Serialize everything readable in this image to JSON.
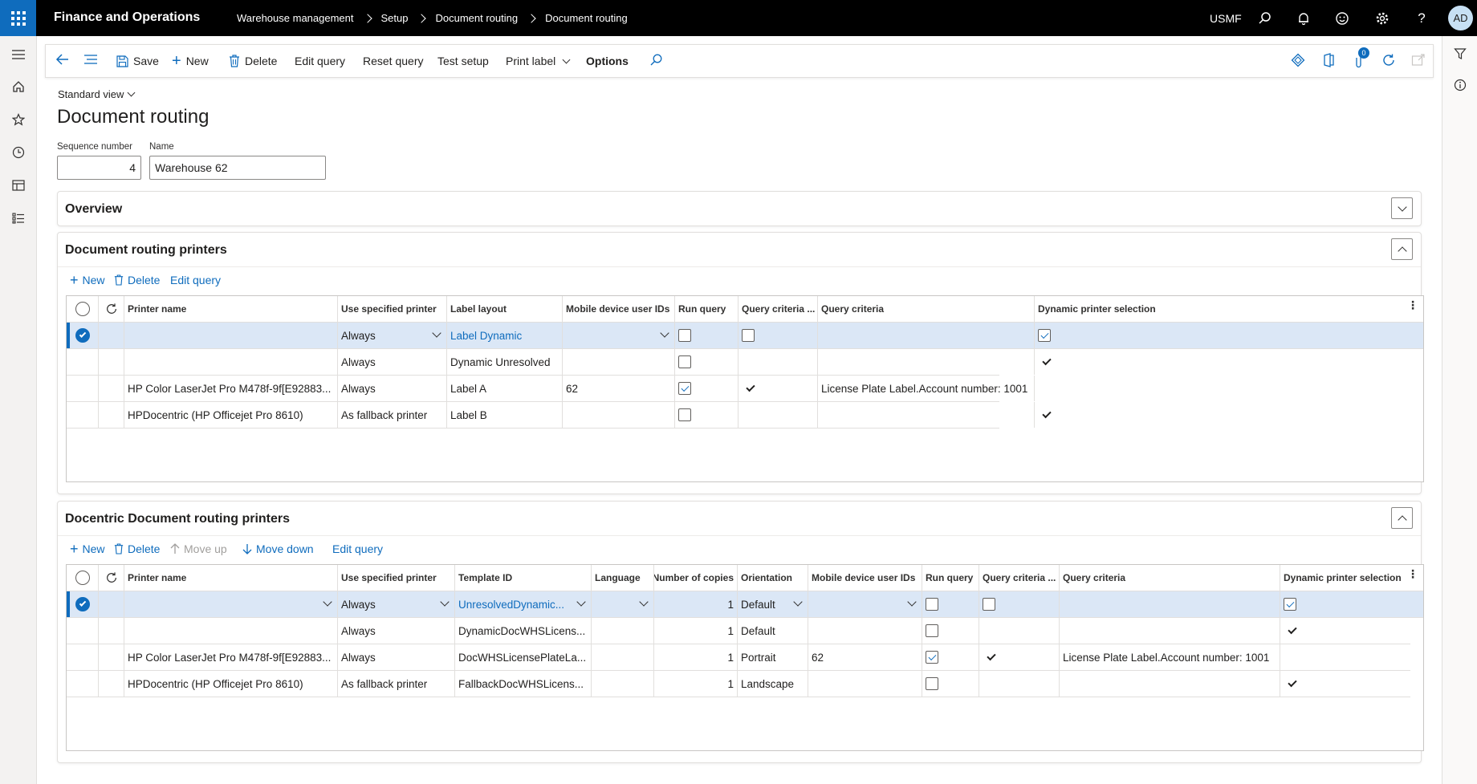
{
  "topbar": {
    "app_name": "Finance and Operations",
    "breadcrumbs": [
      "Warehouse management",
      "Setup",
      "Document routing",
      "Document routing"
    ],
    "company": "USMF",
    "avatar_initials": "AD"
  },
  "actions": {
    "save": "Save",
    "new": "New",
    "delete": "Delete",
    "edit_query": "Edit query",
    "reset_query": "Reset query",
    "test_setup": "Test setup",
    "print_label": "Print label",
    "options": "Options",
    "badge_count": "0"
  },
  "page": {
    "view_label": "Standard view",
    "title": "Document routing",
    "sequence_label": "Sequence number",
    "sequence_value": "4",
    "name_label": "Name",
    "name_value": "Warehouse 62"
  },
  "overview": {
    "title": "Overview"
  },
  "routing_printers": {
    "title": "Document routing printers",
    "toolbar": {
      "new": "New",
      "delete": "Delete",
      "edit_query": "Edit query"
    },
    "columns": [
      "Printer name",
      "Use specified printer",
      "Label layout",
      "Mobile device user IDs",
      "Run query",
      "Query criteria ...",
      "Query criteria",
      "Dynamic printer selection"
    ],
    "rows": [
      {
        "printer": "",
        "use": "Always",
        "layout": "Label Dynamic",
        "mobile": "",
        "run_query": false,
        "qc_flag": false,
        "criteria": "",
        "dynamic": true
      },
      {
        "printer": "",
        "use": "Always",
        "layout": "Dynamic Unresolved",
        "mobile": "",
        "run_query": false,
        "qc_flag": false,
        "criteria": "",
        "dynamic": true
      },
      {
        "printer": "HP Color LaserJet Pro M478f-9f[E92883...",
        "use": "Always",
        "layout": "Label A",
        "mobile": "62",
        "run_query": true,
        "qc_flag": true,
        "criteria": "License Plate Label.Account number: 1001",
        "dynamic": false
      },
      {
        "printer": "HPDocentric (HP Officejet Pro 8610)",
        "use": "As fallback printer",
        "layout": "Label B",
        "mobile": "",
        "run_query": false,
        "qc_flag": false,
        "criteria": "",
        "dynamic": true
      }
    ]
  },
  "docentric_printers": {
    "title": "Docentric Document routing printers",
    "toolbar": {
      "new": "New",
      "delete": "Delete",
      "move_up": "Move up",
      "move_down": "Move down",
      "edit_query": "Edit query"
    },
    "columns": [
      "Printer name",
      "Use specified printer",
      "Template ID",
      "Language",
      "Number of copies",
      "Orientation",
      "Mobile device user IDs",
      "Run query",
      "Query criteria ...",
      "Query criteria",
      "Dynamic printer selection"
    ],
    "rows": [
      {
        "printer": "",
        "use": "Always",
        "template": "UnresolvedDynamic...",
        "language": "",
        "copies": "1",
        "orientation": "Default",
        "mobile": "",
        "run_query": false,
        "qc_flag": false,
        "criteria": "",
        "dynamic": true
      },
      {
        "printer": "",
        "use": "Always",
        "template": "DynamicDocWHSLicens...",
        "language": "",
        "copies": "1",
        "orientation": "Default",
        "mobile": "",
        "run_query": false,
        "qc_flag": false,
        "criteria": "",
        "dynamic": true
      },
      {
        "printer": "HP Color LaserJet Pro M478f-9f[E92883...",
        "use": "Always",
        "template": "DocWHSLicensePlateLa...",
        "language": "",
        "copies": "1",
        "orientation": "Portrait",
        "mobile": "62",
        "run_query": true,
        "qc_flag": true,
        "criteria": "License Plate Label.Account number: 1001",
        "dynamic": false
      },
      {
        "printer": "HPDocentric (HP Officejet Pro 8610)",
        "use": "As fallback printer",
        "template": "FallbackDocWHSLicens...",
        "language": "",
        "copies": "1",
        "orientation": "Landscape",
        "mobile": "",
        "run_query": false,
        "qc_flag": false,
        "criteria": "",
        "dynamic": true
      }
    ]
  }
}
